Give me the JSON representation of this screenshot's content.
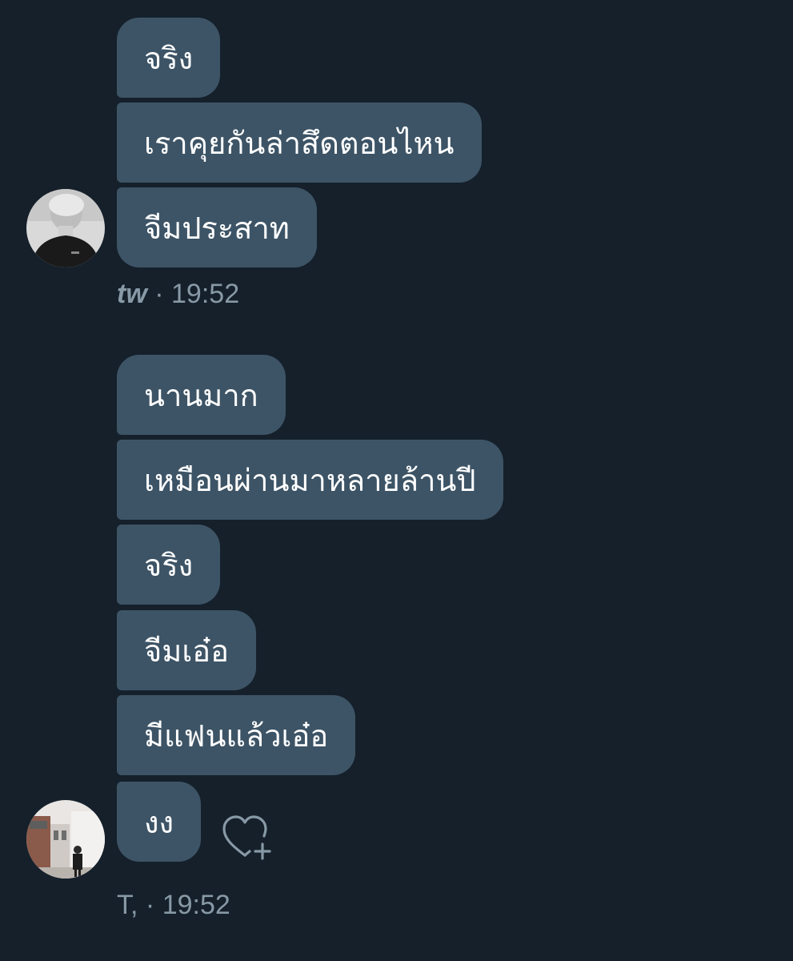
{
  "group1": {
    "messages": [
      "จริง",
      "เราคุยกันล่าสึดตอนไหน",
      "จีมประสาท"
    ],
    "sender": "tw",
    "separator": "·",
    "time": "19:52"
  },
  "group2": {
    "messages": [
      "นานมาก",
      "เหมือนผ่านมาหลายล้านปี",
      "จริง",
      "จีมเอ๋อ",
      "มีแฟนแล้วเอ๋อ",
      "งง"
    ],
    "sender": "T,",
    "separator": "·",
    "time": "19:52"
  },
  "icons": {
    "avatar1": "avatar-grayscale-photo",
    "avatar2": "avatar-street-photo",
    "reaction": "heart-plus-icon"
  },
  "colors": {
    "background": "#15202b",
    "bubble": "#3d5466",
    "meta_text": "#8899a6"
  }
}
